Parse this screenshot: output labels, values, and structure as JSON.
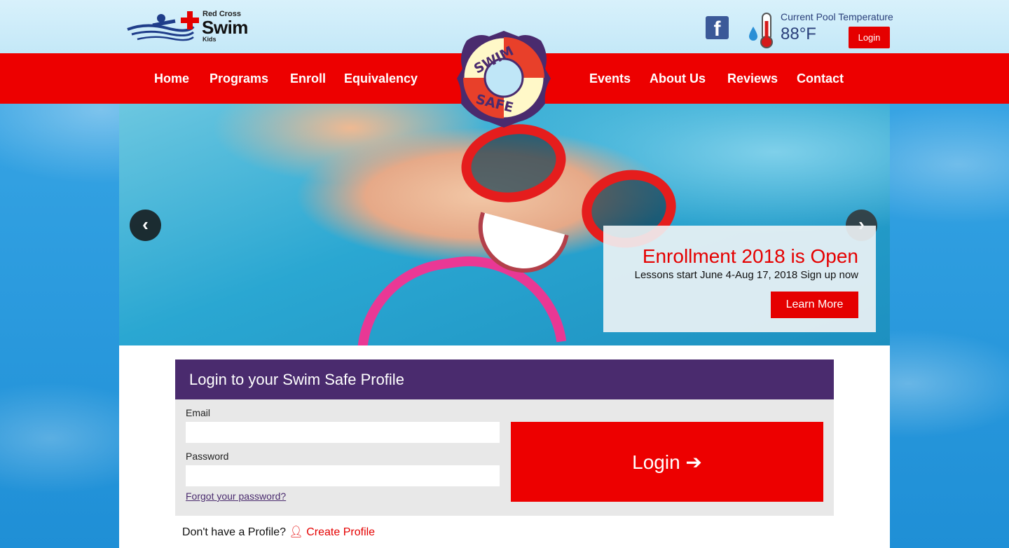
{
  "brand": {
    "small": "Red Cross",
    "big": "Swim",
    "kids": "Kids"
  },
  "header": {
    "pool_label": "Current Pool Temperature",
    "pool_temp": "88°F",
    "login_label": "Login"
  },
  "nav": {
    "left": [
      "Home",
      "Programs",
      "Enroll",
      "Equivalency"
    ],
    "right": [
      "Events",
      "About Us",
      "Reviews",
      "Contact"
    ]
  },
  "logo": {
    "top": "SWIM",
    "bottom": "SAFE"
  },
  "hero": {
    "title": "Enrollment 2018 is Open",
    "subtitle": "Lessons start June 4-Aug 17, 2018 Sign up now",
    "button": "Learn More",
    "prev": "‹",
    "next": "›"
  },
  "login_panel": {
    "title": "Login to your Swim Safe Profile",
    "email_label": "Email",
    "email_value": "",
    "password_label": "Password",
    "password_value": "",
    "forgot": "Forgot your password?",
    "button": "Login ➔",
    "no_profile": "Don't have a Profile?",
    "create": "Create Profile"
  },
  "colors": {
    "red": "#ed0000",
    "purple": "#4a2b6e",
    "facebook": "#3b5998"
  }
}
